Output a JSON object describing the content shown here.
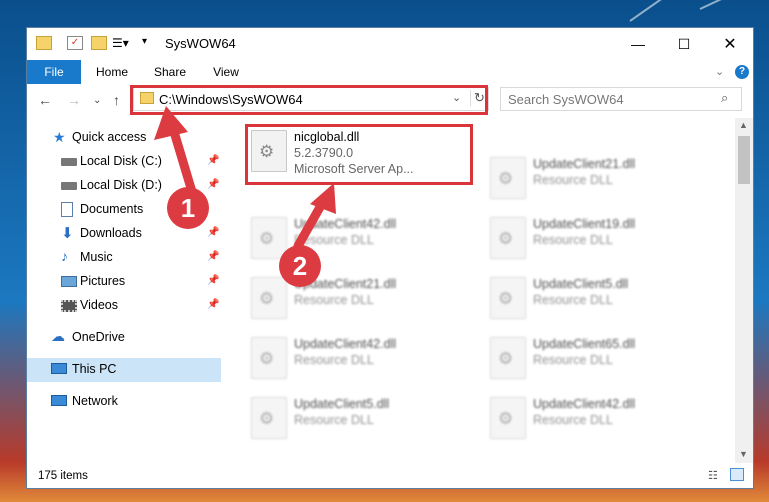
{
  "window": {
    "title": "SysWOW64"
  },
  "ribbon": {
    "tabs": [
      "File",
      "Home",
      "Share",
      "View"
    ]
  },
  "address": {
    "path": "C:\\Windows\\SysWOW64"
  },
  "search": {
    "placeholder": "Search SysWOW64"
  },
  "nav": {
    "items": [
      {
        "label": "Quick access",
        "icon": "star-icon"
      },
      {
        "label": "Local Disk (C:)",
        "icon": "drive-icon"
      },
      {
        "label": "Local Disk (D:)",
        "icon": "drive-icon"
      },
      {
        "label": "Documents",
        "icon": "documents-icon"
      },
      {
        "label": "Downloads",
        "icon": "download-arrow-icon"
      },
      {
        "label": "Music",
        "icon": "music-icon"
      },
      {
        "label": "Pictures",
        "icon": "pictures-icon"
      },
      {
        "label": "Videos",
        "icon": "videos-icon"
      },
      {
        "label": "OneDrive",
        "icon": "cloud-icon"
      },
      {
        "label": "This PC",
        "icon": "computer-icon"
      },
      {
        "label": "Network",
        "icon": "network-icon"
      }
    ]
  },
  "files": {
    "col1": [
      {
        "name": "nicglobal.dll",
        "line2": "5.2.3790.0",
        "line3": "Microsoft Server Ap..."
      },
      {
        "name": "UpdateClient42.dll",
        "line2": "Resource DLL"
      },
      {
        "name": "UpdateClient21.dll",
        "line2": "Resource DLL"
      },
      {
        "name": "UpdateClient42.dll",
        "line2": "Resource DLL"
      },
      {
        "name": "UpdateClient5.dll",
        "line2": "Resource DLL"
      }
    ],
    "col2": [
      {
        "name": "UpdateClient21.dll",
        "line2": "Resource DLL"
      },
      {
        "name": "UpdateClient19.dll",
        "line2": "Resource DLL"
      },
      {
        "name": "UpdateClient5.dll",
        "line2": "Resource DLL"
      },
      {
        "name": "UpdateClient65.dll",
        "line2": "Resource DLL"
      },
      {
        "name": "UpdateClient42.dll",
        "line2": "Resource DLL"
      }
    ]
  },
  "status": {
    "count": "175 items"
  },
  "annotations": {
    "step1": "1",
    "step2": "2"
  },
  "colors": {
    "accent": "#1979ca",
    "highlight": "#d9343a"
  }
}
